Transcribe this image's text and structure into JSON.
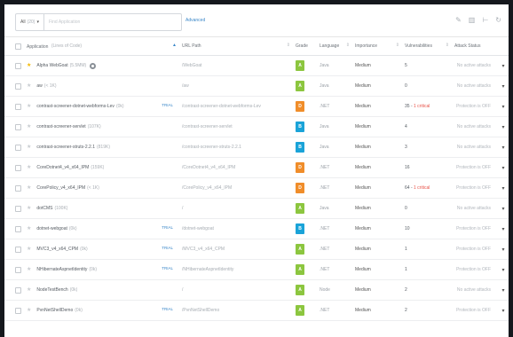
{
  "toolbar": {
    "scope_label": "All",
    "scope_count": "(20)",
    "search_placeholder": "Find Application",
    "advanced_label": "Advanced"
  },
  "columns": {
    "application": "Application",
    "application_sub": "(Lines of Code)",
    "url_path": "URL Path",
    "grade": "Grade",
    "language": "Language",
    "importance": "Importance",
    "vulnerabilities": "Vulnerabilities",
    "attack_status": "Attack Status"
  },
  "colors": {
    "A": "#8cc63f",
    "B": "#1aa3d8",
    "D": "#f08d2a"
  },
  "rows": [
    {
      "name": "Alpha WebGoat",
      "loc": "(5.5MM)",
      "star": true,
      "gear": true,
      "trial": "",
      "url": "/WebGoat",
      "grade": "A",
      "language": "Java",
      "importance": "Medium",
      "vuln": "5",
      "crit": "",
      "attack": "No active attacks"
    },
    {
      "name": "aw",
      "loc": "(< 1K)",
      "star": false,
      "gear": false,
      "trial": "",
      "url": "/aw",
      "grade": "A",
      "language": "Java",
      "importance": "Medium",
      "vuln": "0",
      "crit": "",
      "attack": "No active attacks"
    },
    {
      "name": "contrast-screener-dotnet-webforms-Lev",
      "loc": "(0k)",
      "star": false,
      "gear": false,
      "trial": "TRIAL",
      "url": "/contrast-screener-dotnet-webforms-Lev",
      "grade": "D",
      "language": ".NET",
      "importance": "Medium",
      "vuln": "35 - ",
      "crit": "1 critical",
      "attack": "Protection is OFF"
    },
    {
      "name": "contrast-screener-servlet",
      "loc": "(107K)",
      "star": false,
      "gear": false,
      "trial": "",
      "url": "/contrast-screener-servlet",
      "grade": "B",
      "language": "Java",
      "importance": "Medium",
      "vuln": "4",
      "crit": "",
      "attack": "No active attacks"
    },
    {
      "name": "contrast-screener-struts-2.2.1",
      "loc": "(819K)",
      "star": false,
      "gear": false,
      "trial": "",
      "url": "/contrast-screener-struts-2.2.1",
      "grade": "B",
      "language": "Java",
      "importance": "Medium",
      "vuln": "3",
      "crit": "",
      "attack": "No active attacks"
    },
    {
      "name": "CoreDotnet4_v4_x64_IPM",
      "loc": "(159K)",
      "star": false,
      "gear": false,
      "trial": "",
      "url": "/CoreDotnet4_v4_x64_IPM",
      "grade": "D",
      "language": ".NET",
      "importance": "Medium",
      "vuln": "16",
      "crit": "",
      "attack": "Protection is OFF"
    },
    {
      "name": "CorePolicy_v4_x64_IPM",
      "loc": "(< 1K)",
      "star": false,
      "gear": false,
      "trial": "",
      "url": "/CorePolicy_v4_x64_IPM",
      "grade": "D",
      "language": ".NET",
      "importance": "Medium",
      "vuln": "64 - ",
      "crit": "1 critical",
      "attack": "Protection is OFF"
    },
    {
      "name": "dotCMS",
      "loc": "(100K)",
      "star": false,
      "gear": false,
      "trial": "",
      "url": "/",
      "grade": "A",
      "language": "Java",
      "importance": "Medium",
      "vuln": "0",
      "crit": "",
      "attack": "No active attacks"
    },
    {
      "name": "dotnet-webgoat",
      "loc": "(0k)",
      "star": false,
      "gear": false,
      "trial": "TRIAL",
      "url": "/dotnet-webgoat",
      "grade": "B",
      "language": ".NET",
      "importance": "Medium",
      "vuln": "10",
      "crit": "",
      "attack": "Protection is OFF"
    },
    {
      "name": "MVC3_v4_x64_CPM",
      "loc": "(0k)",
      "star": false,
      "gear": false,
      "trial": "TRIAL",
      "url": "/MVC3_v4_x64_CPM",
      "grade": "A",
      "language": ".NET",
      "importance": "Medium",
      "vuln": "1",
      "crit": "",
      "attack": "Protection is OFF"
    },
    {
      "name": "NHibernateAspnetIdentity",
      "loc": "(0k)",
      "star": false,
      "gear": false,
      "trial": "TRIAL",
      "url": "/NHibernateAspnetIdentity",
      "grade": "A",
      "language": ".NET",
      "importance": "Medium",
      "vuln": "1",
      "crit": "",
      "attack": "Protection is OFF"
    },
    {
      "name": "NodeTestBench",
      "loc": "(0k)",
      "star": false,
      "gear": false,
      "trial": "",
      "url": "/",
      "grade": "A",
      "language": "Node",
      "importance": "Medium",
      "vuln": "2",
      "crit": "",
      "attack": "No active attacks"
    },
    {
      "name": "PvnNetShellDemo",
      "loc": "(0k)",
      "star": false,
      "gear": false,
      "trial": "TRIAL",
      "url": "/PvnNetShellDemo",
      "grade": "A",
      "language": ".NET",
      "importance": "Medium",
      "vuln": "2",
      "crit": "",
      "attack": "Protection is OFF"
    }
  ]
}
